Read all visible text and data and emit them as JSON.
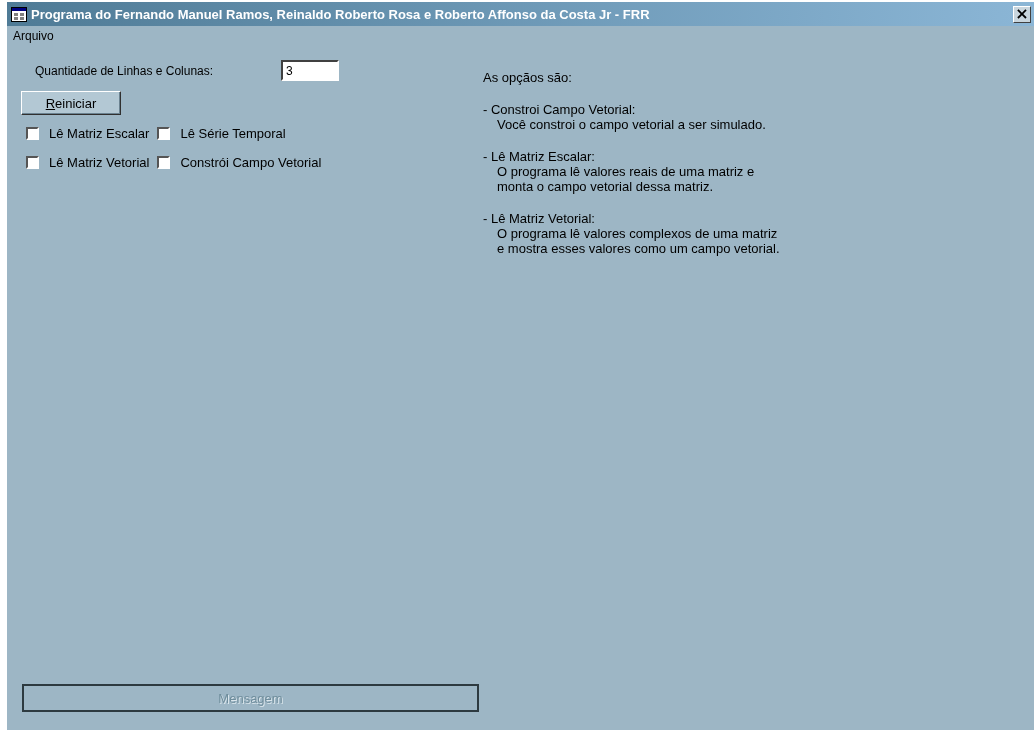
{
  "window": {
    "title": "Programa do Fernando Manuel Ramos, Reinaldo Roberto Rosa e Roberto Affonso da Costa Jr - FRR",
    "close": "×"
  },
  "menu": [
    "Arquivo"
  ],
  "size_field": {
    "label": "Quantidade de Linhas e Colunas:",
    "value": "3"
  },
  "reset_button": "Reiniciar",
  "options": [
    {
      "label": "Lê Matriz Escalar",
      "checked": false
    },
    {
      "label": "Lê Série Temporal",
      "checked": false
    },
    {
      "label": "Lê Matriz Vetorial",
      "checked": false
    },
    {
      "label": "Constrói Campo Vetorial",
      "checked": false
    }
  ],
  "help": {
    "intro": "As opçãos são:",
    "items": [
      {
        "heading": "- Constroi Campo Vetorial:",
        "text": "Você constroi o campo vetorial a ser simulado."
      },
      {
        "heading": "- Lê Matriz Escalar:",
        "text": "O programa lê valores reais de uma matriz e\nmonta o campo vetorial dessa matriz."
      },
      {
        "heading": "- Lê Matriz Vetorial:",
        "text": "O programa lê valores complexos de uma matriz\ne mostra esses valores como um campo vetorial."
      }
    ]
  },
  "message_button": {
    "label": "Mensagem",
    "disabled": true
  }
}
